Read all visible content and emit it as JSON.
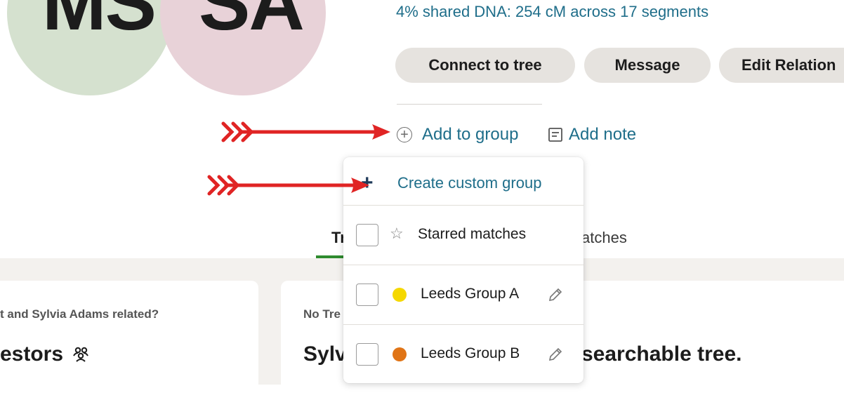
{
  "profile": {
    "initials_left": "MS",
    "initials_right": "SA",
    "avatar_left_color": "#d5e1cf",
    "avatar_right_color": "#e8d2d8",
    "shared_dna": "4% shared DNA: 254 cM across 17 segments"
  },
  "actions": {
    "connect_to_tree": "Connect to tree",
    "message": "Message",
    "edit_relationship": "Edit Relation"
  },
  "links": {
    "add_to_group": "Add to group",
    "add_note": "Add note"
  },
  "dropdown": {
    "create_custom_group": "Create custom group",
    "items": [
      {
        "label": "Starred matches",
        "icon": "star-icon"
      },
      {
        "label": "Leeds Group A",
        "color": "#f5d800",
        "icon": "pencil-icon"
      },
      {
        "label": "Leeds Group B",
        "color": "#e07416",
        "icon": "pencil-icon"
      }
    ]
  },
  "tabs": {
    "tab1_partial": "Tr",
    "tab2_partial": "atches"
  },
  "cards": {
    "left_question": "t and Sylvia Adams related?",
    "left_heading": "estors",
    "right_question": "No Tre",
    "right_heading_start": "Sylv",
    "right_heading_end": "searchable tree."
  },
  "annotations": {
    "arrow_color": "#e02424"
  }
}
